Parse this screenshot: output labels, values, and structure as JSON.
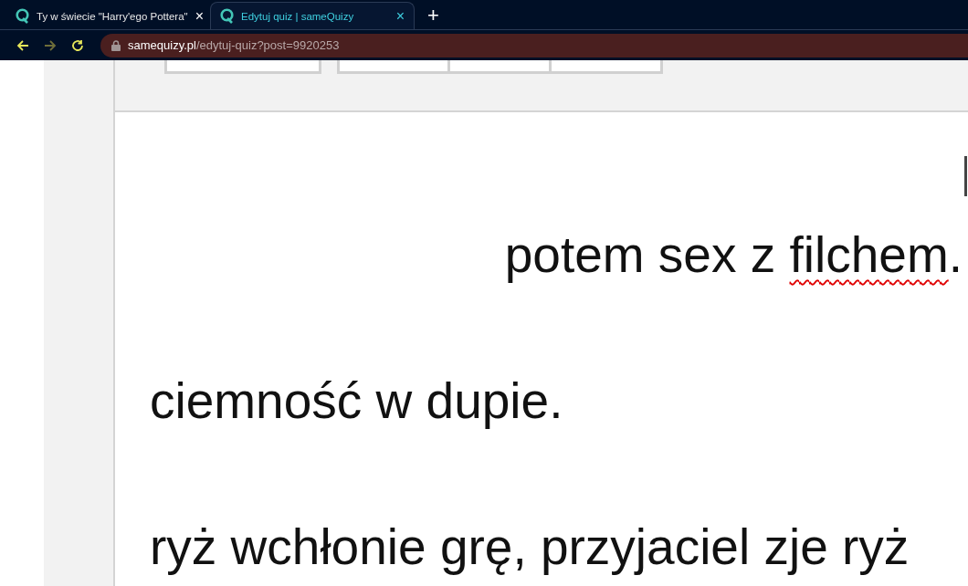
{
  "browser": {
    "tabs": [
      {
        "title": "Ty w świecie \"Harry'ego Pottera\"",
        "close": "×",
        "selected": false
      },
      {
        "title": "Edytuj quiz | sameQuizy",
        "close": "×",
        "selected": true
      }
    ],
    "new_tab": "+",
    "address": {
      "host": "samequizy.pl",
      "path": "/edytuj-quiz?post=9920253"
    }
  },
  "editor": {
    "paragraphs": [
      {
        "right_aligned": true,
        "parts": [
          {
            "text": "potem sex z "
          },
          {
            "text": "filchem",
            "misspelled": true
          },
          {
            "text": "."
          }
        ]
      },
      {
        "right_aligned": false,
        "parts": [
          {
            "text": "ciemność w dupie."
          }
        ]
      },
      {
        "right_aligned": false,
        "parts": [
          {
            "text": "ryż wchłonie grę, przyjaciel zje ryż"
          }
        ]
      }
    ]
  }
}
